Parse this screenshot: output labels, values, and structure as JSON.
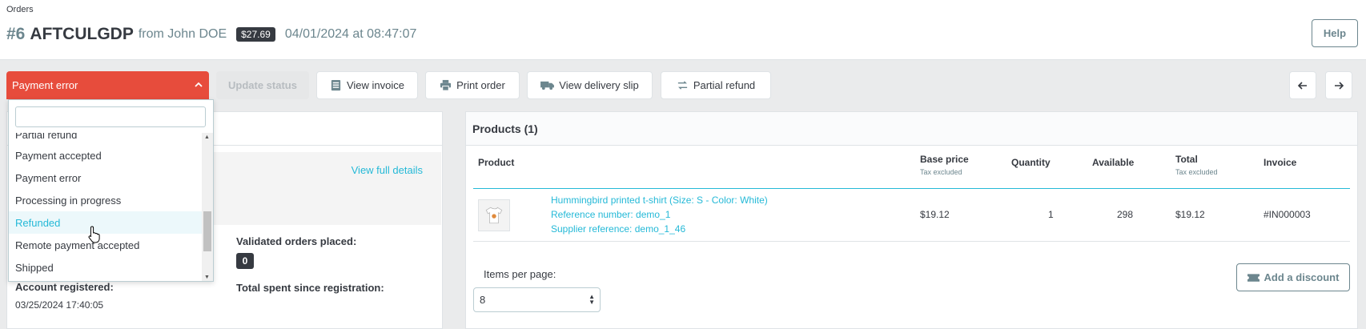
{
  "breadcrumb": "Orders",
  "order": {
    "number": "#6",
    "reference": "AFTCULGDP",
    "from": "from John DOE",
    "total": "$27.69",
    "date": "04/01/2024 at 08:47:07"
  },
  "help_label": "Help",
  "status": {
    "selected": "Payment error",
    "options": [
      "Partial refund",
      "Payment accepted",
      "Payment error",
      "Processing in progress",
      "Refunded",
      "Remote payment accepted",
      "Shipped"
    ],
    "highlighted": "Refunded"
  },
  "toolbar": {
    "update_status": "Update status",
    "view_invoice": "View invoice",
    "print_order": "Print order",
    "view_delivery_slip": "View delivery slip",
    "partial_refund": "Partial refund"
  },
  "customer": {
    "view_full_details": "View full details",
    "validated_orders_label": "Validated orders placed:",
    "validated_orders_value": "0",
    "account_registered_label": "Account registered:",
    "account_registered_value": "03/25/2024 17:40:05",
    "total_spent_label": "Total spent since registration:"
  },
  "products": {
    "title": "Products (1)",
    "columns": {
      "product": "Product",
      "base_price": "Base price",
      "base_price_sub": "Tax excluded",
      "quantity": "Quantity",
      "available": "Available",
      "total": "Total",
      "total_sub": "Tax excluded",
      "invoice": "Invoice"
    },
    "rows": [
      {
        "name": "Hummingbird printed t-shirt (Size: S - Color: White)",
        "reference": "Reference number: demo_1",
        "supplier": "Supplier reference: demo_1_46",
        "base_price": "$19.12",
        "quantity": "1",
        "available": "298",
        "total": "$19.12",
        "invoice": "#IN000003"
      }
    ],
    "items_per_page_label": "Items per page:",
    "items_per_page": "8",
    "add_discount": "Add a discount"
  },
  "colors": {
    "status_error": "#e74c3c",
    "link": "#25b9d7",
    "dark": "#363a41"
  }
}
